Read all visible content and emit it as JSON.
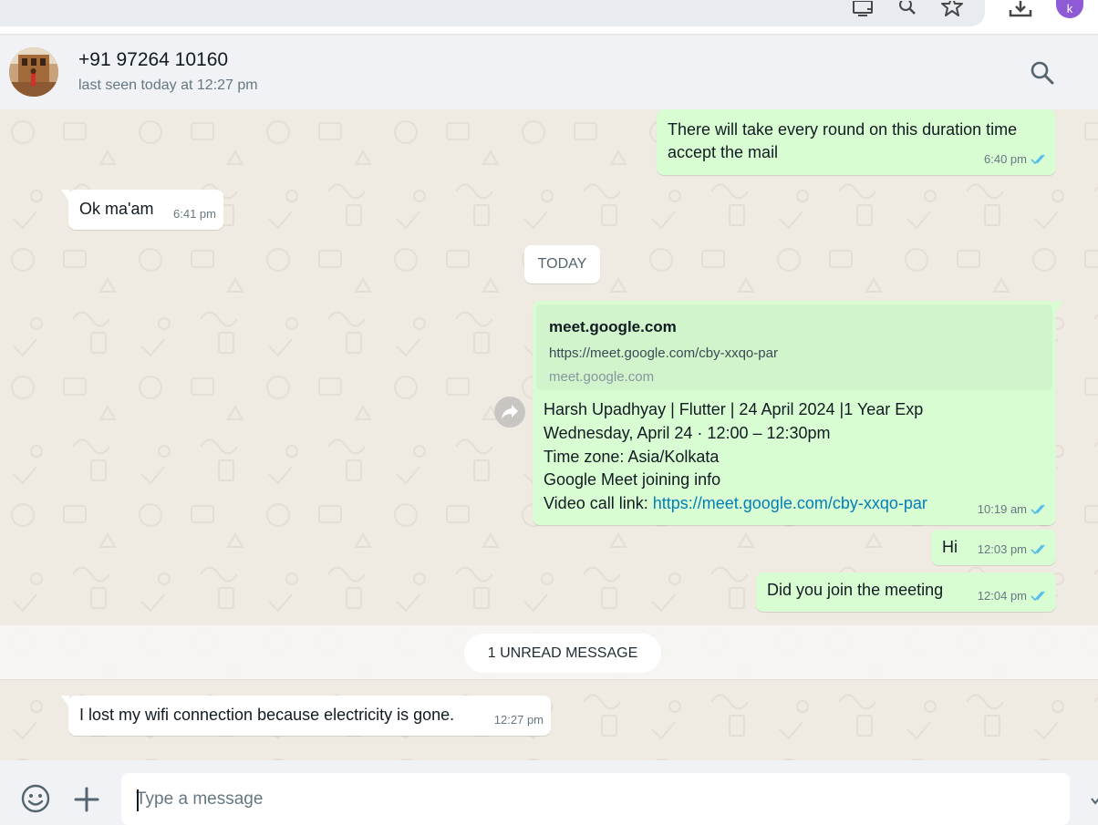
{
  "browser": {
    "profile_initial": "k"
  },
  "header": {
    "contact_name": "+91 97264 10160",
    "status": "last seen today at 12:27 pm"
  },
  "messages": [
    {
      "direction": "out",
      "text_line1": "There will take every round on this duration time",
      "text_line2": "accept the mail",
      "time": "6:40 pm",
      "status": "read"
    },
    {
      "direction": "in",
      "text": "Ok ma'am",
      "time": "6:41 pm"
    },
    {
      "direction": "out",
      "text": "Hi",
      "time": "12:03 pm",
      "status": "read"
    },
    {
      "direction": "out",
      "text": "Did you join the meeting",
      "time": "12:04 pm",
      "status": "read"
    },
    {
      "direction": "in",
      "text": "I lost my wifi connection because electricity is gone.",
      "time": "12:27 pm"
    }
  ],
  "date_divider": "TODAY",
  "meeting_message": {
    "preview": {
      "title": "meet.google.com",
      "url": "https://meet.google.com/cby-xxqo-par",
      "domain": "meet.google.com"
    },
    "lines": [
      "Harsh Upadhyay | Flutter | 24 April 2024 |1 Year Exp",
      "Wednesday, April 24 · 12:00 – 12:30pm",
      "Time zone: Asia/Kolkata",
      "Google Meet joining info"
    ],
    "link_prefix": "Video call link: ",
    "link_text": "https://meet.google.com/cby-xxqo-par",
    "time": "10:19 am",
    "status": "read"
  },
  "unread_divider": "1 UNREAD MESSAGE",
  "composer": {
    "placeholder": "Type a message"
  },
  "colors": {
    "outgoing_bubble": "#d9fdd3",
    "incoming_bubble": "#ffffff",
    "read_tick": "#53bdeb",
    "link": "#027eb5",
    "chat_background": "#efeae2"
  }
}
